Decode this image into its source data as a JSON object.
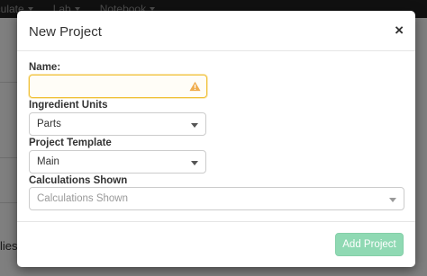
{
  "navbar": {
    "items": [
      {
        "label": "lculate"
      },
      {
        "label": "Lab"
      },
      {
        "label": "Notebook"
      }
    ]
  },
  "background": {
    "partial_text": "lies"
  },
  "modal": {
    "title": "New Project",
    "close_label": "×",
    "fields": {
      "name": {
        "label": "Name:",
        "value": "",
        "state": "warning"
      },
      "ingredient_units": {
        "label": "Ingredient Units",
        "value": "Parts"
      },
      "project_template": {
        "label": "Project Template",
        "value": "Main"
      },
      "calculations_shown": {
        "label": "Calculations Shown",
        "placeholder": "Calculations Shown"
      }
    },
    "add_button": {
      "label": "Add Project",
      "color": "#8fd9b3"
    }
  },
  "colors": {
    "warning": "#f0ad4e",
    "navbar": "#222222"
  }
}
